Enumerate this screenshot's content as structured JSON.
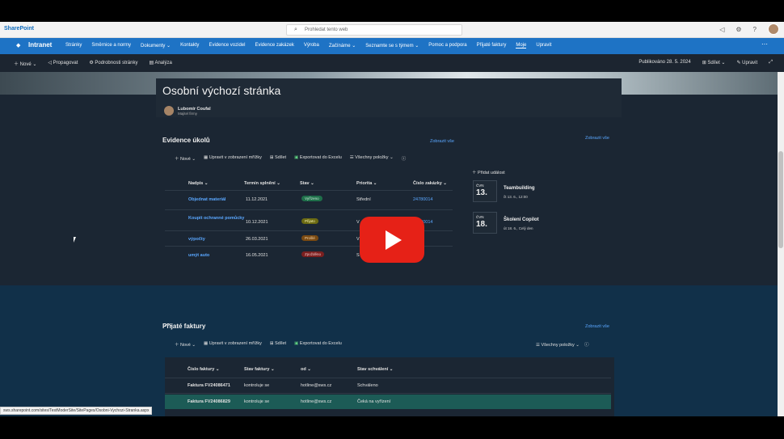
{
  "suite": {
    "brand": "SharePoint",
    "search_placeholder": "Prohledat tento web"
  },
  "hub": {
    "site": "Intranet",
    "links": [
      "Stránky",
      "Směrnice a normy",
      "Dokumenty ⌄",
      "Kontakty",
      "Evidence vozidel",
      "Evidence zakázek",
      "Výroba",
      "Začínáme ⌄",
      "Seznamte se s týmem ⌄",
      "Pomoc a podpora",
      "Přijaté faktury",
      "Moje",
      "Upravit"
    ]
  },
  "commandbar": {
    "new": "Nové",
    "promote": "Propagovat",
    "details": "Podrobnosti stránky",
    "analytics": "Analýza",
    "published": "Publikováno 28. 5. 2024",
    "share": "Sdílet",
    "edit": "Upravit"
  },
  "page": {
    "title": "Osobní výchozí stránka",
    "author_name": "Lubomír Coufal",
    "author_role": "Majitel firmy"
  },
  "tasks": {
    "title": "Evidence úkolů",
    "see_all": "Zobrazit vše",
    "toolbar": {
      "new": "Nové",
      "grid": "Upravit v zobrazení mřížky",
      "share": "Sdílet",
      "export": "Exportovat do Excelu",
      "all_items": "Všechny položky"
    },
    "headers": [
      "Nadpis",
      "Termín splnění",
      "Stav",
      "Priorita",
      "Číslo zakázky"
    ],
    "rows": [
      {
        "title": "Objednat materiál",
        "date": "11.12.2021",
        "status": "Vyřízeno",
        "priority": "Střední",
        "order": "24780014"
      },
      {
        "title": "Koupit ochranné pomůcky",
        "date": "10.12.2021",
        "status": "Přijato",
        "priority": "V",
        "order": "24780014"
      },
      {
        "title": "výpočty",
        "date": "26.03.2021",
        "status": "Prošlé",
        "priority": "V",
        "order": "2023"
      },
      {
        "title": "umýt auto",
        "date": "16.05.2021",
        "status": "Zpožděno",
        "priority": "S",
        "order": "2023"
      }
    ],
    "status_colors": {
      "Vyřízeno": "#1f6f4a",
      "Přijato": "#6b6a12",
      "Prošlé": "#7a4a12",
      "Zpožděno": "#7a1f1f"
    }
  },
  "events": {
    "see_all": "Zobrazit vše",
    "add": "Přidat událost",
    "items": [
      {
        "month": "ČVN",
        "day": "13.",
        "title": "Teambuilding",
        "sub": "čt 13. 6., 12:00"
      },
      {
        "month": "ČVN",
        "day": "18.",
        "title": "Školení Copilot",
        "sub": "út 18. 6., Celý den"
      }
    ]
  },
  "invoices": {
    "title": "Přijaté faktury",
    "see_all": "Zobrazit vše",
    "toolbar": {
      "new": "Nové",
      "grid": "Upravit v zobrazení mřížky",
      "share": "Sdílet",
      "export": "Exportovat do Excelu",
      "all_items": "Všechny položky"
    },
    "headers": [
      "Číslo faktury",
      "Stav faktury",
      "od",
      "Stav schválení"
    ],
    "rows": [
      {
        "number": "Faktura FV24086471",
        "state": "kontroluje se",
        "from": "hotline@sws.cz",
        "approval": "Schváleno"
      },
      {
        "number": "Faktura FV24086829",
        "state": "kontroluje se",
        "from": "hotline@sws.cz",
        "approval": "Čeká na vyřízení"
      }
    ]
  },
  "status_url": "sws.sharepoint.com/sites/TestModerSite/SitePages/Osobni-Vychozi-Stranka.aspx",
  "colors": {
    "accent": "#1e73c5",
    "play": "#e62117"
  }
}
